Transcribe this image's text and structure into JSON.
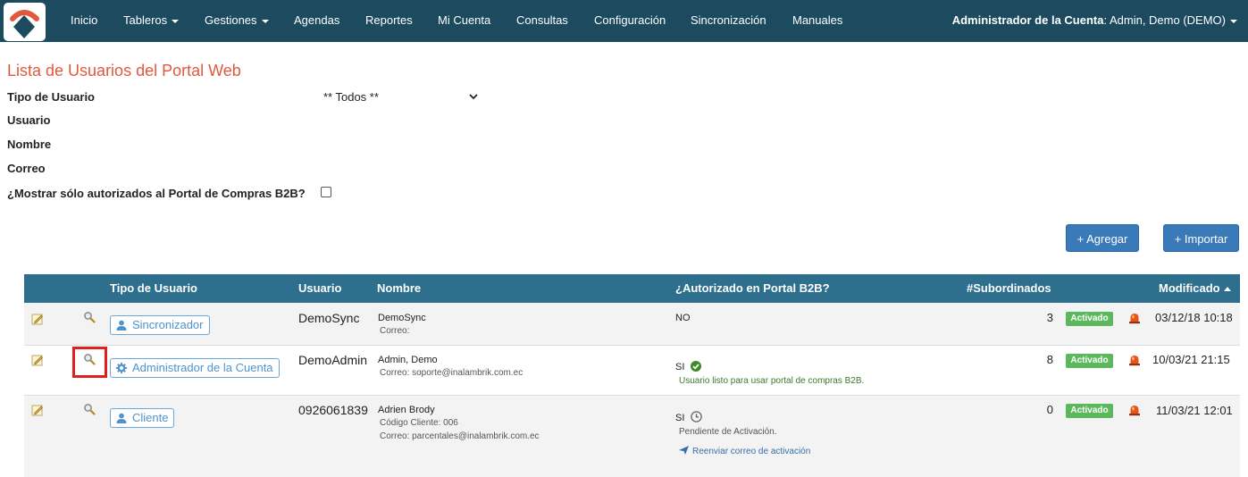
{
  "nav": {
    "items": [
      "Inicio",
      "Tableros",
      "Gestiones",
      "Agendas",
      "Reportes",
      "Mi Cuenta",
      "Consultas",
      "Configuración",
      "Sincronización",
      "Manuales"
    ],
    "user_role": "Administrador de la Cuenta",
    "user_name": ": Admin, Demo (DEMO)"
  },
  "page": {
    "title": "Lista de Usuarios del Portal Web"
  },
  "form": {
    "tipo_label": "Tipo de Usuario",
    "tipo_value": "** Todos **",
    "usuario_label": "Usuario",
    "nombre_label": "Nombre",
    "correo_label": "Correo",
    "b2b_label": "¿Mostrar sólo autorizados al Portal de Compras B2B?"
  },
  "buttons": {
    "add": "+ Agregar",
    "import": "+ Importar"
  },
  "table": {
    "headers": {
      "tipo": "Tipo de Usuario",
      "usuario": "Usuario",
      "nombre": "Nombre",
      "autorizado": "¿Autorizado en Portal B2B?",
      "subordinados": "#Subordinados",
      "modificado": "Modificado"
    },
    "rows": [
      {
        "tipo": "Sincronizador",
        "usuario": "DemoSync",
        "nombre": "DemoSync",
        "codigo": "",
        "correo": "Correo:",
        "autorizado": "NO",
        "auth_note": "",
        "resend": "",
        "subordinados": "3",
        "estado": "Activado",
        "modificado": "03/12/18 10:18"
      },
      {
        "tipo": "Administrador de la Cuenta",
        "usuario": "DemoAdmin",
        "nombre": "Admin, Demo",
        "codigo": "",
        "correo": "Correo: soporte@inalambrik.com.ec",
        "autorizado": "SI",
        "auth_note": "Usuario listo para usar portal de compras B2B.",
        "resend": "",
        "subordinados": "8",
        "estado": "Activado",
        "modificado": "10/03/21 21:15"
      },
      {
        "tipo": "Cliente",
        "usuario": "0926061839",
        "nombre": "Adrien Brody",
        "codigo": "Código Cliente: 006",
        "correo": "Correo: parcentales@inalambrik.com.ec",
        "autorizado": "SI",
        "auth_note": "Pendiente de Activación.",
        "resend": "Reenviar correo de activación",
        "subordinados": "0",
        "estado": "Activado",
        "modificado": "11/03/21 12:01"
      }
    ]
  },
  "colors": {
    "navbar": "#1c4a5e",
    "table_header": "#2d6f8c",
    "title": "#e2583e",
    "badge": "#5cb85c",
    "button": "#3a7ab8",
    "highlight": "#e0201f"
  }
}
